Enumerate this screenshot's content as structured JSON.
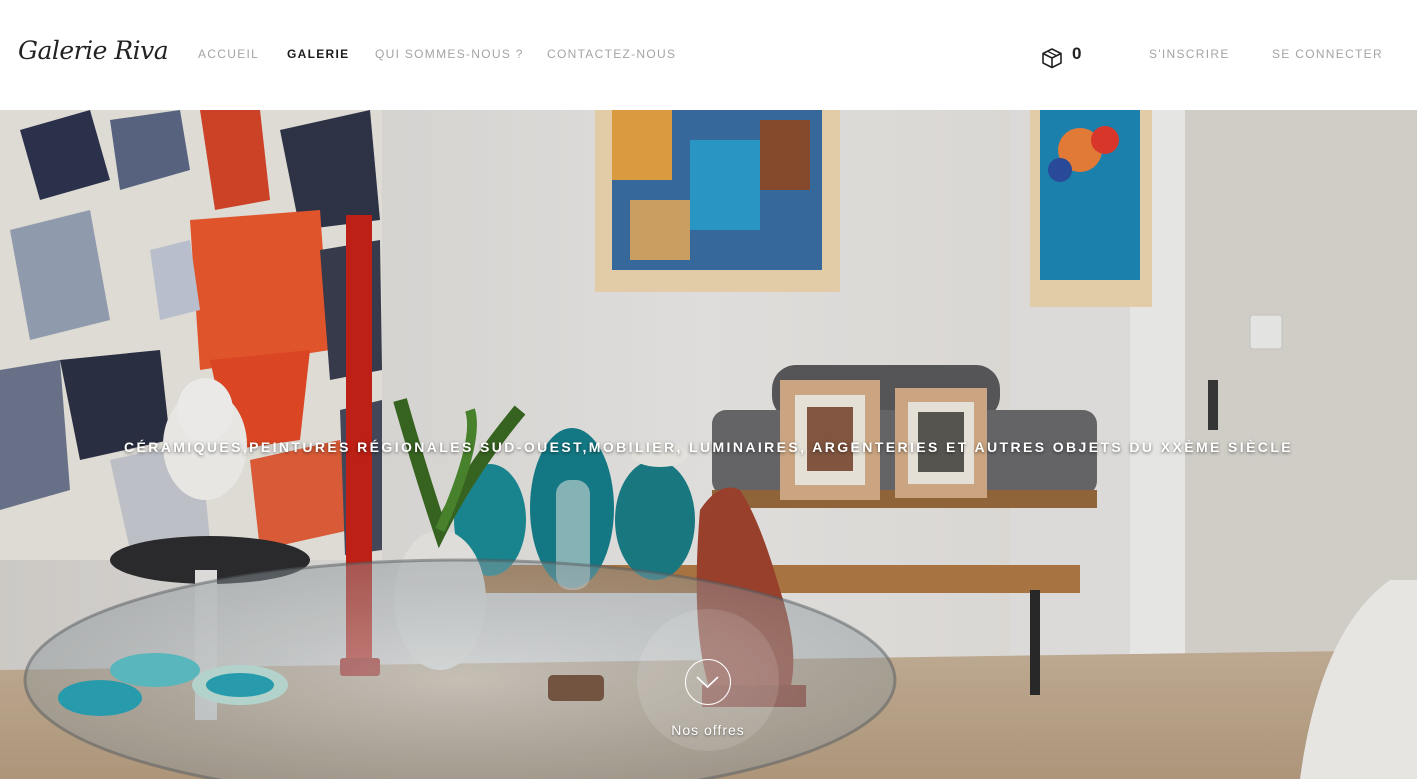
{
  "header": {
    "logo": "Galerie Riva",
    "nav": {
      "home": "ACCUEIL",
      "gallery": "GALERIE",
      "about": "QUI SOMMES-NOUS ?",
      "contact": "CONTACTEZ-NOUS"
    },
    "cart": {
      "icon": "box-icon",
      "count": "0"
    },
    "account": {
      "register": "S'INSCRIRE",
      "login": "SE CONNECTER"
    }
  },
  "hero": {
    "tagline": "CÉRAMIQUES,PEINTURES RÉGIONALES SUD-OUEST,MOBILIER, LUMINAIRES, ARGENTERIES ET AUTRES OBJETS DU XXÈME SIÈCLE",
    "scroll": {
      "icon": "chevron-down-icon",
      "label": "Nos offres"
    }
  },
  "colors": {
    "nav_inactive": "#a4a4a4",
    "nav_active": "#1d1d1d",
    "background": "#ffffff"
  }
}
